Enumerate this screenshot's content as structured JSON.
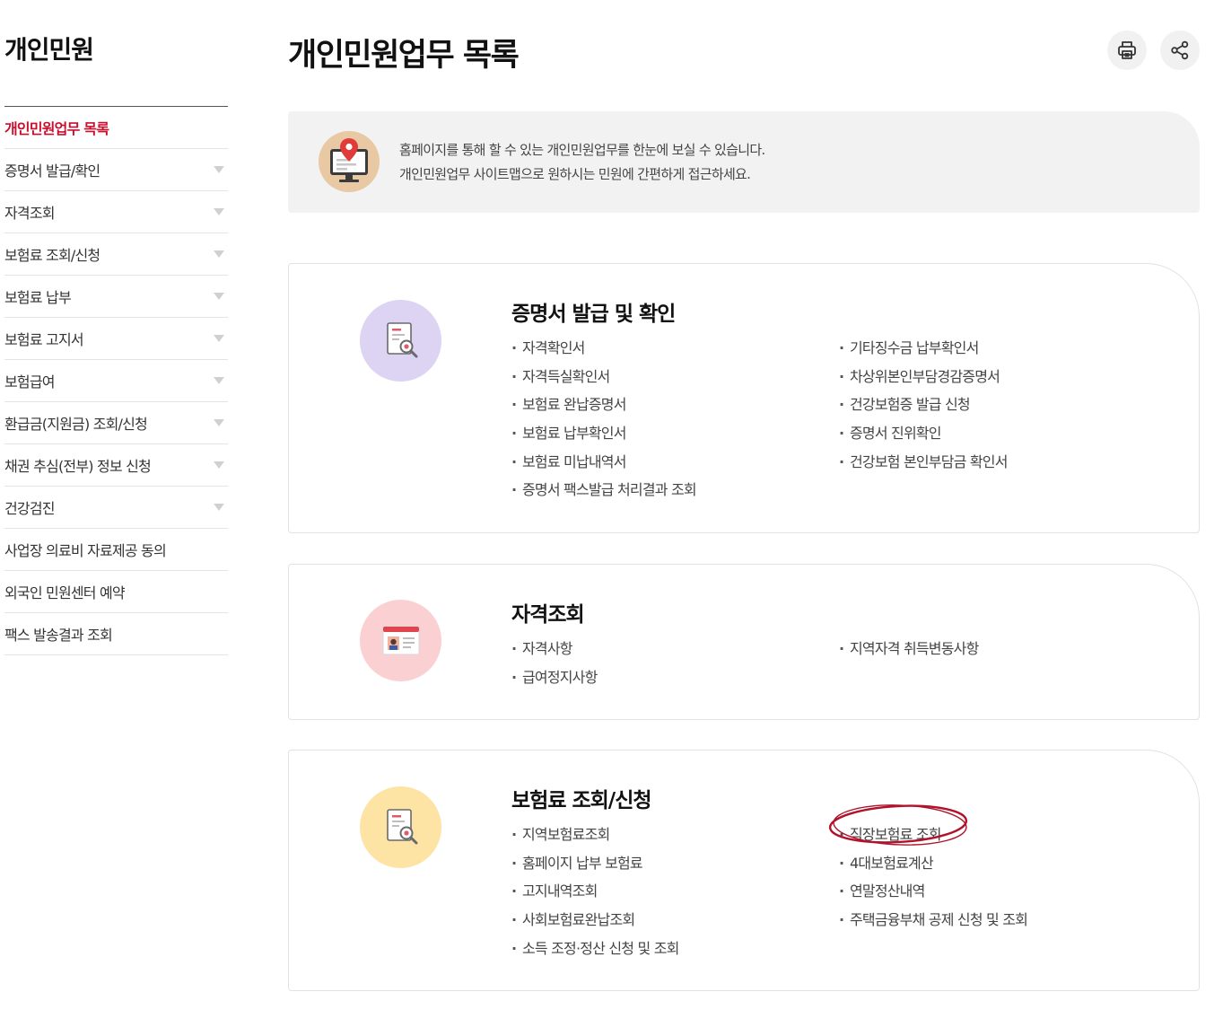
{
  "sidebar": {
    "title": "개인민원",
    "items": [
      {
        "label": "개인민원업무 목록",
        "active": true,
        "expandable": false
      },
      {
        "label": "증명서 발급/확인",
        "expandable": true
      },
      {
        "label": "자격조회",
        "expandable": true
      },
      {
        "label": "보험료 조회/신청",
        "expandable": true
      },
      {
        "label": "보험료 납부",
        "expandable": true
      },
      {
        "label": "보험료 고지서",
        "expandable": true
      },
      {
        "label": "보험급여",
        "expandable": true
      },
      {
        "label": "환급금(지원금) 조회/신청",
        "expandable": true
      },
      {
        "label": "채권 추심(전부) 정보 신청",
        "expandable": true
      },
      {
        "label": "건강검진",
        "expandable": true
      },
      {
        "label": "사업장 의료비 자료제공 동의",
        "expandable": false
      },
      {
        "label": "외국인 민원센터 예약",
        "expandable": false
      },
      {
        "label": "팩스 발송결과 조회",
        "expandable": false
      }
    ]
  },
  "header": {
    "title": "개인민원업무 목록",
    "print_icon": "printer-icon",
    "share_icon": "share-icon"
  },
  "intro": {
    "icon": "monitor-location-icon",
    "line1": "홈페이지를 통해 할 수 있는 개인민원업무를 한눈에 보실 수 있습니다.",
    "line2": "개인민원업무 사이트맵으로 원하시는 민원에 간편하게 접근하세요."
  },
  "sections": [
    {
      "title": "증명서 발급 및 확인",
      "icon": "document-search-icon",
      "icon_bg": "#ddd3f3",
      "left": [
        "자격확인서",
        "자격득실확인서",
        "보험료 완납증명서",
        "보험료 납부확인서",
        "보험료 미납내역서",
        "증명서 팩스발급 처리결과 조회"
      ],
      "right": [
        "기타징수금 납부확인서",
        "차상위본인부담경감증명서",
        "건강보험증 발급 신청",
        "증명서 진위확인",
        "건강보험 본인부담금 확인서"
      ]
    },
    {
      "title": "자격조회",
      "icon": "id-card-icon",
      "icon_bg": "#fbd0d3",
      "left": [
        "자격사항",
        "급여정지사항"
      ],
      "right": [
        "지역자격 취득변동사항"
      ]
    },
    {
      "title": "보험료 조회/신청",
      "icon": "document-search-icon",
      "icon_bg": "#fde4a5",
      "left": [
        "지역보험료조회",
        "홈페이지 납부 보험료",
        "고지내역조회",
        "사회보험료완납조회",
        "소득 조정·정산 신청 및 조회"
      ],
      "right": [
        "직장보험료 조회",
        "4대보험료계산",
        "연말정산내역",
        "주택금융부채 공제 신청 및 조회"
      ],
      "highlighted": "직장보험료 조회"
    }
  ],
  "colors": {
    "accent": "#c8102e",
    "highlight_circle": "#b0132b"
  }
}
